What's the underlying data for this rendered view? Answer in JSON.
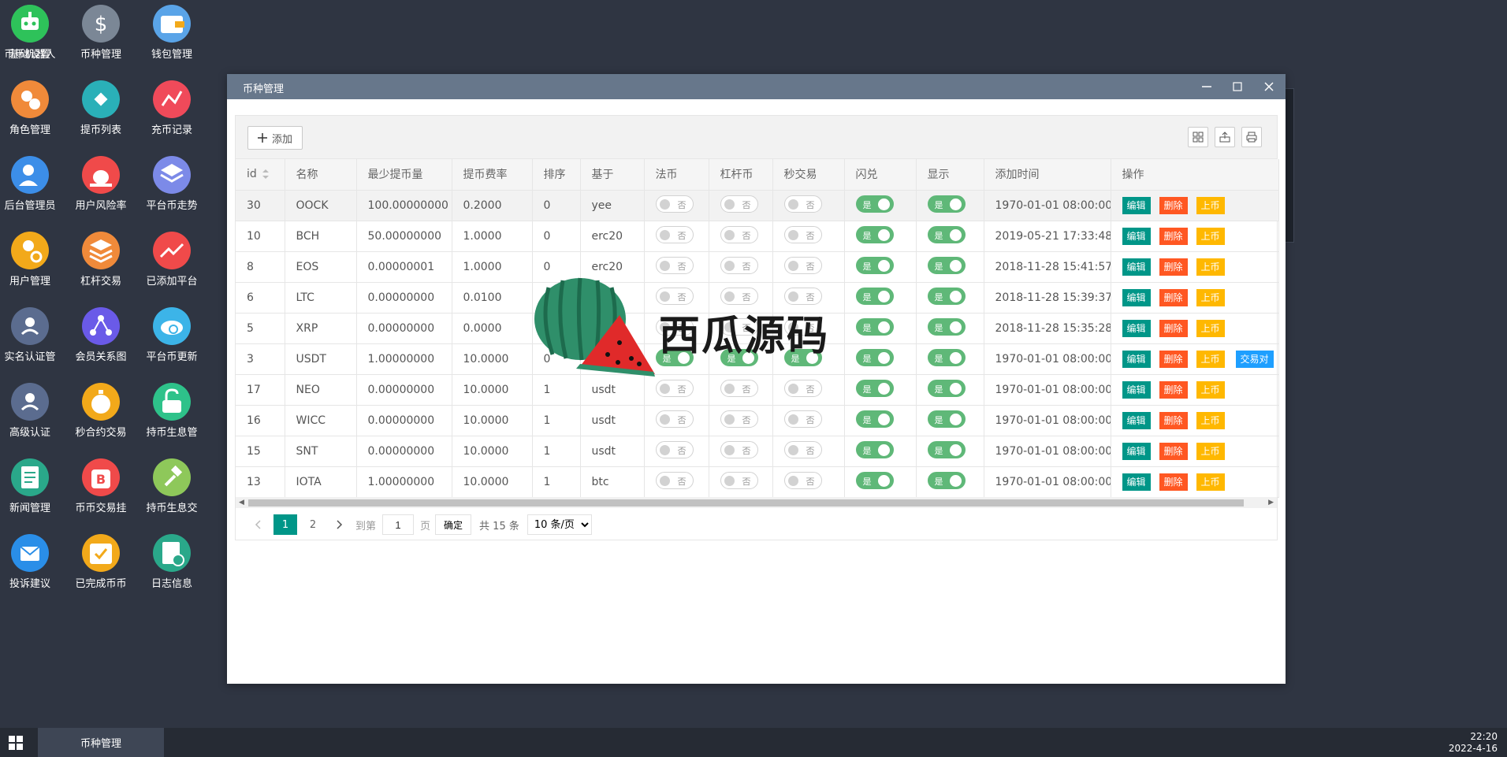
{
  "desktop_icons": [
    {
      "label": "基础设置",
      "icon": "gear-icon",
      "color": "#5b6c8f"
    },
    {
      "label": "币种管理",
      "icon": "dollar-icon",
      "color": "#7b8796"
    },
    {
      "label": "钱包管理",
      "icon": "wallet-icon",
      "color": "#5aa4e8"
    },
    {
      "label": "角色管理",
      "icon": "role-icon",
      "color": "#f08a3a"
    },
    {
      "label": "提币列表",
      "icon": "coin-withdraw-icon",
      "color": "#2ab0b8"
    },
    {
      "label": "充币记录",
      "icon": "chart-record-icon",
      "color": "#f04a5a"
    },
    {
      "label": "后台管理员",
      "icon": "admin-icon",
      "color": "#3c8ee8"
    },
    {
      "label": "用户风险率",
      "icon": "alarm-icon",
      "color": "#f04a4a"
    },
    {
      "label": "平台币走势",
      "icon": "layers-icon",
      "color": "#7c8ae8"
    },
    {
      "label": "用户管理",
      "icon": "user-search-icon",
      "color": "#f2a91a"
    },
    {
      "label": "杠杆交易",
      "icon": "stack-icon",
      "color": "#f08a3a"
    },
    {
      "label": "已添加平台",
      "icon": "trend-icon",
      "color": "#f04a4a"
    },
    {
      "label": "实名认证管",
      "icon": "verify-user-icon",
      "color": "#5b6c8f"
    },
    {
      "label": "会员关系图",
      "icon": "network-icon",
      "color": "#6a5ae8"
    },
    {
      "label": "平台币更新",
      "icon": "cloud-sync-icon",
      "color": "#3cb4e8"
    },
    {
      "label": "高级认证",
      "icon": "advanced-verify-icon",
      "color": "#5b6c8f"
    },
    {
      "label": "秒合约交易",
      "icon": "stopwatch-icon",
      "color": "#f2a91a"
    },
    {
      "label": "持币生息管",
      "icon": "unlock-icon",
      "color": "#2ec28a"
    },
    {
      "label": "新闻管理",
      "icon": "news-icon",
      "color": "#2aa88a"
    },
    {
      "label": "币币交易挂",
      "icon": "bitcoin-icon",
      "color": "#f04a4a"
    },
    {
      "label": "持币生息交",
      "icon": "hammer-icon",
      "color": "#8ec85a"
    },
    {
      "label": "投诉建议",
      "icon": "mail-icon",
      "color": "#2a8ee8"
    },
    {
      "label": "已完成币币",
      "icon": "done-icon",
      "color": "#f2a91a"
    },
    {
      "label": "日志信息",
      "icon": "log-icon",
      "color": "#2aa88a"
    },
    {
      "label": "币币机器人",
      "icon": "robot-icon",
      "color": "#2ec25a"
    }
  ],
  "window": {
    "title": "币种管理",
    "add_label": "添加",
    "columns": [
      "id",
      "名称",
      "最少提币量",
      "提币费率",
      "排序",
      "基于",
      "法币",
      "杠杆币",
      "秒交易",
      "闪兑",
      "显示",
      "添加时间",
      "操作"
    ],
    "yes": "是",
    "no": "否",
    "btn_edit": "编辑",
    "btn_delete": "删除",
    "btn_list": "上币",
    "btn_pair": "交易对",
    "rows": [
      {
        "id": "30",
        "name": "OOCK",
        "min": "100.00000000",
        "rate": "0.2000",
        "sort": "0",
        "base": "yee",
        "fiat": false,
        "lever": false,
        "second": false,
        "flash": true,
        "show": true,
        "time": "1970-01-01 08:00:00",
        "pair": false
      },
      {
        "id": "10",
        "name": "BCH",
        "min": "50.00000000",
        "rate": "1.0000",
        "sort": "0",
        "base": "erc20",
        "fiat": false,
        "lever": false,
        "second": false,
        "flash": true,
        "show": true,
        "time": "2019-05-21 17:33:48",
        "pair": false
      },
      {
        "id": "8",
        "name": "EOS",
        "min": "0.00000001",
        "rate": "1.0000",
        "sort": "0",
        "base": "erc20",
        "fiat": false,
        "lever": false,
        "second": false,
        "flash": true,
        "show": true,
        "time": "2018-11-28 15:41:57",
        "pair": false
      },
      {
        "id": "6",
        "name": "LTC",
        "min": "0.00000000",
        "rate": "0.0100",
        "sort": "0",
        "base": "",
        "fiat": false,
        "lever": false,
        "second": false,
        "flash": true,
        "show": true,
        "time": "2018-11-28 15:39:37",
        "pair": false
      },
      {
        "id": "5",
        "name": "XRP",
        "min": "0.00000000",
        "rate": "0.0000",
        "sort": "",
        "base": "",
        "fiat": false,
        "lever": false,
        "second": false,
        "flash": true,
        "show": true,
        "time": "2018-11-28 15:35:28",
        "pair": false
      },
      {
        "id": "3",
        "name": "USDT",
        "min": "1.00000000",
        "rate": "10.0000",
        "sort": "0",
        "base": "",
        "fiat": true,
        "lever": true,
        "second": true,
        "flash": true,
        "show": true,
        "time": "1970-01-01 08:00:00",
        "pair": true
      },
      {
        "id": "17",
        "name": "NEO",
        "min": "0.00000000",
        "rate": "10.0000",
        "sort": "1",
        "base": "usdt",
        "fiat": false,
        "lever": false,
        "second": false,
        "flash": true,
        "show": true,
        "time": "1970-01-01 08:00:00",
        "pair": false
      },
      {
        "id": "16",
        "name": "WICC",
        "min": "0.00000000",
        "rate": "10.0000",
        "sort": "1",
        "base": "usdt",
        "fiat": false,
        "lever": false,
        "second": false,
        "flash": true,
        "show": true,
        "time": "1970-01-01 08:00:00",
        "pair": false
      },
      {
        "id": "15",
        "name": "SNT",
        "min": "0.00000000",
        "rate": "10.0000",
        "sort": "1",
        "base": "usdt",
        "fiat": false,
        "lever": false,
        "second": false,
        "flash": true,
        "show": true,
        "time": "1970-01-01 08:00:00",
        "pair": false
      },
      {
        "id": "13",
        "name": "IOTA",
        "min": "1.00000000",
        "rate": "10.0000",
        "sort": "1",
        "base": "btc",
        "fiat": false,
        "lever": false,
        "second": false,
        "flash": true,
        "show": true,
        "time": "1970-01-01 08:00:00",
        "pair": false
      }
    ],
    "pager": {
      "pages": [
        "1",
        "2"
      ],
      "current": "1",
      "goto_prefix": "到第",
      "goto_value": "1",
      "goto_suffix": "页",
      "ok": "确定",
      "total": "共 15 条",
      "page_size": "10 条/页"
    }
  },
  "watermark": "西瓜源码",
  "taskbar": {
    "task": "币种管理",
    "time": "22:20",
    "date": "2022-4-16"
  }
}
